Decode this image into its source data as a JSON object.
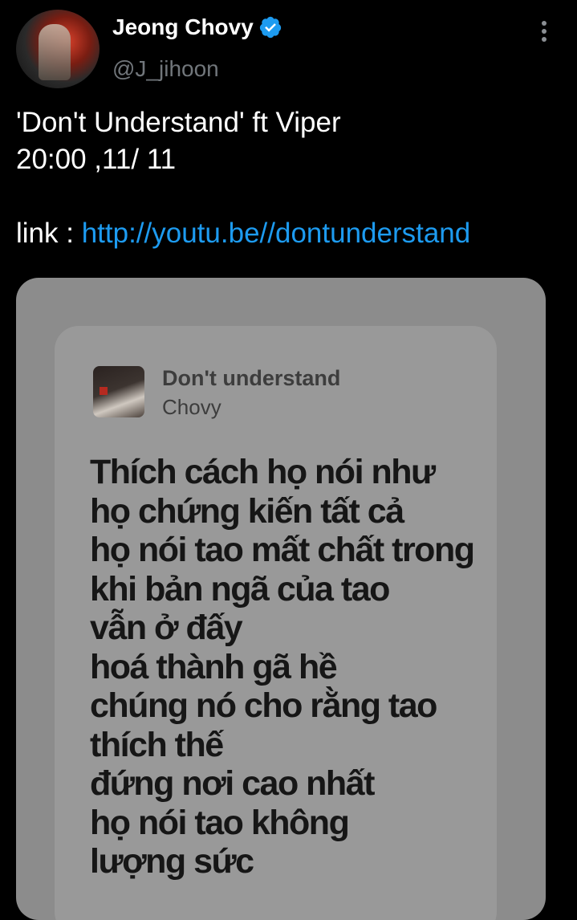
{
  "author": {
    "display_name": "Jeong Chovy",
    "handle": "@J_jihoon",
    "verified": true
  },
  "tweet": {
    "text": "'Don't Understand' ft Viper\n20:00 ,11/ 11\n\nlink : ",
    "link": "http://youtu.be//dontunderstand"
  },
  "lyric_card": {
    "song_title": "Don't understand",
    "artist": "Chovy",
    "lines": [
      "Thích cách họ nói như",
      "họ chứng kiến tất cả",
      "họ nói tao mất chất trong",
      "khi bản ngã của tao",
      "vẫn ở đấy",
      "hoá thành gã hề",
      "chúng nó cho rằng tao",
      "thích thế",
      "đứng nơi cao nhất",
      "họ nói tao không",
      "lượng sức"
    ]
  },
  "colors": {
    "background": "#000000",
    "link": "#1d9bf0",
    "verified": "#1d9bf0",
    "handle": "#71767b"
  },
  "icons": [
    "verified-badge-icon",
    "more-options-icon"
  ]
}
